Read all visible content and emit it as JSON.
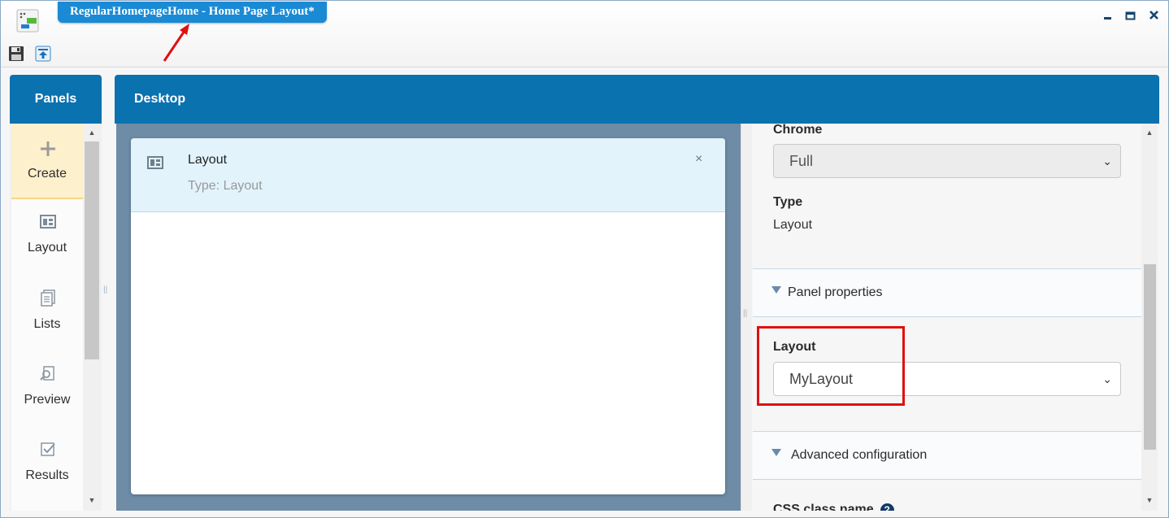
{
  "window": {
    "title": "RegularHomepageHome - Home Page Layout*",
    "controls": {
      "minimize": "‒",
      "maximize": "▭",
      "close": "✕"
    }
  },
  "toolbar": {
    "save_icon": "floppy-disk-icon",
    "publish_icon": "publish-icon"
  },
  "panels": {
    "header": "Panels",
    "items": [
      {
        "label": "Create",
        "icon": "plus-icon"
      },
      {
        "label": "Layout",
        "icon": "layout-icon"
      },
      {
        "label": "Lists",
        "icon": "lists-icon"
      },
      {
        "label": "Preview",
        "icon": "preview-icon"
      },
      {
        "label": "Results",
        "icon": "results-icon"
      }
    ]
  },
  "desktop": {
    "header": "Desktop",
    "card": {
      "title": "Layout",
      "subtitle": "Type: Layout",
      "close": "×"
    }
  },
  "properties": {
    "chrome": {
      "label": "Chrome",
      "value": "Full"
    },
    "type": {
      "label": "Type",
      "value": "Layout"
    },
    "panel_section": "Panel properties",
    "layout": {
      "label": "Layout",
      "value": "MyLayout"
    },
    "advanced_section": "Advanced configuration",
    "css_label": "CSS class name",
    "help": "?"
  },
  "colors": {
    "header_blue": "#0b72b0",
    "title_tab": "#1a8ad4",
    "annotation_red": "#e01010",
    "canvas": "#6e8ca6"
  }
}
